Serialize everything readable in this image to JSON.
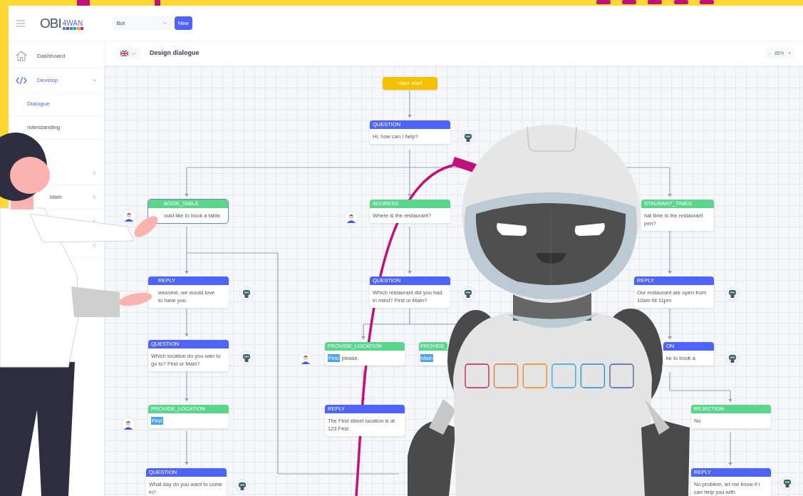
{
  "header": {
    "logo": {
      "main": "OBI",
      "sub": "4WAN"
    },
    "bot_select": {
      "value": "Bot"
    },
    "new_button": "New"
  },
  "sidebar": {
    "items": [
      {
        "label": "Dashboard",
        "kind": "home",
        "selected": false
      },
      {
        "label": "Develop",
        "kind": "code",
        "selected": true,
        "expanded": true,
        "children": [
          {
            "label": "Dialogue",
            "selected": true
          },
          {
            "label": "nderstanding",
            "selected": false
          }
        ]
      },
      {
        "kind": "hidden",
        "expanded": false
      },
      {
        "label": "blish",
        "kind": "hidden",
        "expanded": false
      },
      {
        "kind": "hidden",
        "expanded": false
      },
      {
        "kind": "hidden",
        "expanded": false
      }
    ]
  },
  "toolbar": {
    "title": "Design dialogue",
    "zoom": {
      "minus": "-",
      "value": "85%",
      "plus": "+"
    }
  },
  "canvas": {
    "nodes": [
      {
        "kind": "start",
        "text": "User start"
      },
      {
        "kind": "bot",
        "label": "QUESTION",
        "text": "Hi, how can I help?",
        "avatar": {
          "kind": "bot"
        },
        "selected": false
      },
      {
        "kind": "user",
        "label": "BOOK_TABLE",
        "text": "ould like to book a table.",
        "avatar": {
          "kind": "user"
        },
        "selected": true
      },
      {
        "kind": "user",
        "label": "ADDRESS",
        "text": "Where is the restaurant?",
        "avatar": {
          "kind": "user"
        },
        "selected": false
      },
      {
        "kind": "user",
        "label": "STAURANT_TIMES",
        "text": "hat time is the restaurant\npen?",
        "selected": false
      },
      {
        "kind": "bot",
        "label": "REPLY",
        "text": "wesome, we would love\nto have you.",
        "avatar": {
          "kind": "bot"
        },
        "selected": false
      },
      {
        "kind": "bot",
        "label": "QUESTION",
        "text": "Which restaurant did you had in mind? First or Main?",
        "avatar": {
          "kind": "bot"
        },
        "selected": false
      },
      {
        "kind": "bot",
        "label": "REPLY",
        "text": "Our restaurant are open from 10am till 11pm",
        "avatar": {
          "kind": "bot"
        },
        "selected": false
      },
      {
        "kind": "bot",
        "label": "QUESTION",
        "text": "Which location do you wan to go to? First or Main?",
        "avatar": {
          "kind": "bot"
        },
        "selected": false
      },
      {
        "kind": "user",
        "label": "PROVIDE_LOCATION",
        "tag": "First",
        "text": "please.",
        "avatar": {
          "kind": "user"
        },
        "selected": false
      },
      {
        "kind": "user",
        "label": "PROVIDE_",
        "tag": "Main",
        "selected": false
      },
      {
        "kind": "bot",
        "label": "ON",
        "text": "ke to book a",
        "avatar": {
          "kind": "bot"
        },
        "selected": false
      },
      {
        "kind": "user",
        "label": "PROVIDE_LOCATION",
        "tag": "First",
        "avatar": {
          "kind": "user"
        },
        "selected": false
      },
      {
        "kind": "bot",
        "label": "REPLY",
        "text": "The First street location is at 123 First.",
        "selected": false
      },
      {
        "kind": "user",
        "label": "REJECTION",
        "text": "No",
        "selected": false
      },
      {
        "kind": "bot",
        "label": "QUESTION",
        "text": "What day do you want to come in?",
        "avatar": {
          "kind": "bot"
        },
        "selected": false
      },
      {
        "kind": "bot",
        "label": "REPLY",
        "text": "No problem, let me know if I can help you with",
        "avatar": {
          "kind": "bot"
        },
        "selected": false
      }
    ]
  }
}
